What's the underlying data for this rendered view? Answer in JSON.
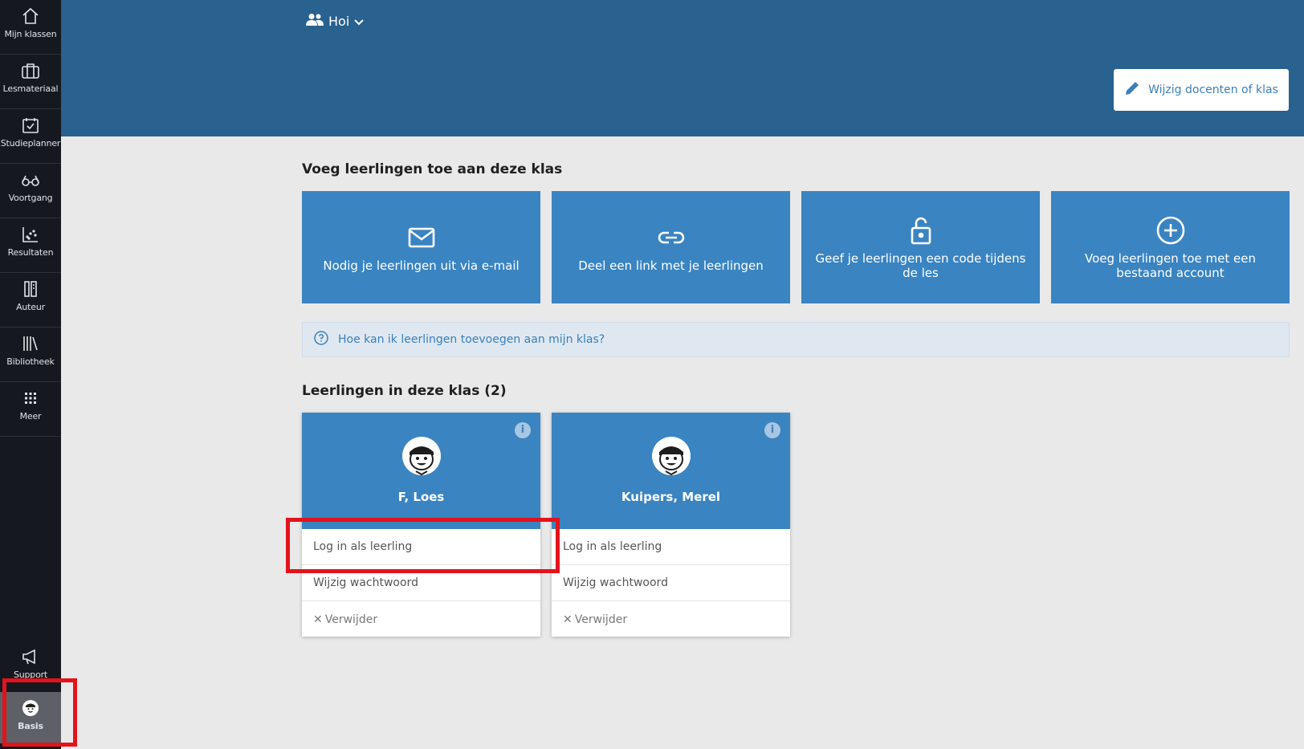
{
  "sidebar": {
    "items": [
      {
        "label": "Mijn klassen",
        "icon": "home-icon"
      },
      {
        "label": "Lesmateriaal",
        "icon": "briefcase-icon"
      },
      {
        "label": "Studieplanner",
        "icon": "calendar-check-icon"
      },
      {
        "label": "Voortgang",
        "icon": "glasses-icon"
      },
      {
        "label": "Resultaten",
        "icon": "scatter-chart-icon"
      },
      {
        "label": "Auteur",
        "icon": "author-icon"
      },
      {
        "label": "Bibliotheek",
        "icon": "library-icon"
      },
      {
        "label": "Meer",
        "icon": "grid-icon"
      }
    ],
    "support_label": "Support",
    "basis_label": "Basis"
  },
  "header": {
    "class_name": "Hoi",
    "edit_button": "Wijzig docenten of klas"
  },
  "add_section": {
    "title": "Voeg leerlingen toe aan deze klas",
    "tiles": [
      {
        "label": "Nodig je leerlingen uit via e-mail",
        "icon": "envelope-icon"
      },
      {
        "label": "Deel een link met je leerlingen",
        "icon": "link-icon"
      },
      {
        "label": "Geef je leerlingen een code tijdens de les",
        "icon": "unlock-icon"
      },
      {
        "label": "Voeg leerlingen toe met een bestaand account",
        "icon": "plus-circle-icon"
      }
    ],
    "help_text": "Hoe kan ik leerlingen toevoegen aan mijn klas?"
  },
  "students_section": {
    "title": "Leerlingen in deze klas (2)",
    "students": [
      {
        "name": "F, Loes",
        "login": "Log in als leerling",
        "password": "Wijzig wachtwoord",
        "remove": "Verwijder"
      },
      {
        "name": "Kuipers, Merel",
        "login": "Log in als leerling",
        "password": "Wijzig wachtwoord",
        "remove": "Verwijder"
      }
    ]
  },
  "colors": {
    "header": "#29618f",
    "tile": "#3a84c1",
    "sidebar": "#15191f",
    "highlight": "#e3121b"
  }
}
